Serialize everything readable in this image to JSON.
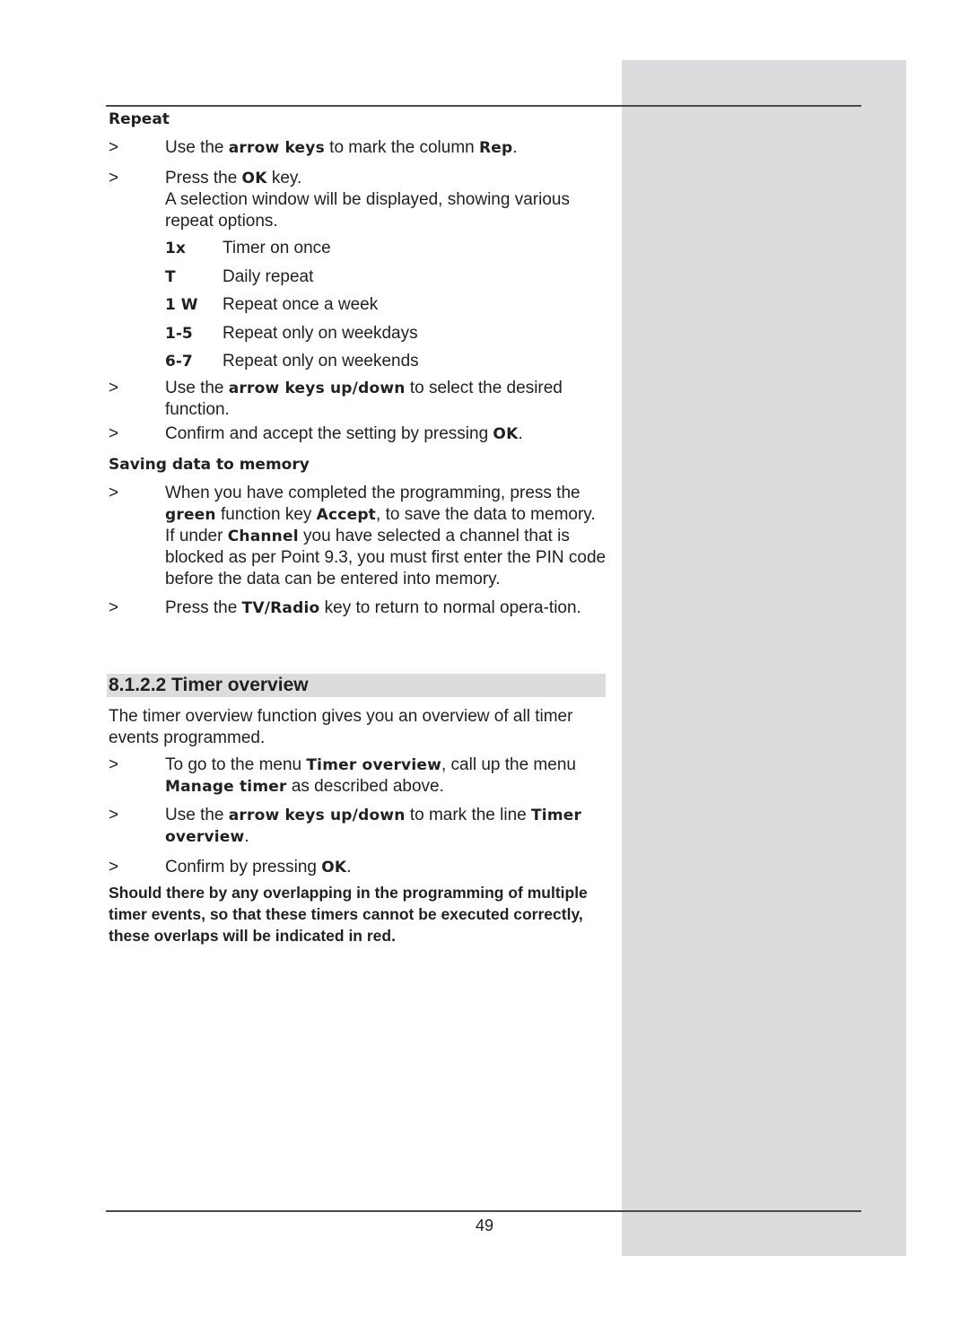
{
  "page": {
    "page_number": "49",
    "colors": {
      "side_panel": "#dcdcde",
      "rule": "#4a4a4a",
      "text": "#231f20"
    }
  },
  "repeat": {
    "heading": "Repeat",
    "step1": {
      "marker": ">",
      "pre": "Use the ",
      "b1": "arrow keys",
      "mid": " to mark the column ",
      "b2": "Rep",
      "post": "."
    },
    "step2": {
      "marker": ">",
      "pre": "Press the ",
      "b1": "OK",
      "post": " key.",
      "detail": "A selection window will be displayed, showing various repeat options."
    },
    "options": [
      {
        "code": "1x",
        "label": "Timer on once"
      },
      {
        "code": "T",
        "label": "Daily repeat"
      },
      {
        "code": "1 W",
        "label": "Repeat once a week"
      },
      {
        "code": "1-5",
        "label": "Repeat only on weekdays"
      },
      {
        "code": "6-7",
        "label": "Repeat only on weekends"
      }
    ],
    "step3": {
      "marker": ">",
      "pre": "Use the ",
      "b1": "arrow keys up/down",
      "post": " to select the desired function."
    },
    "step4": {
      "marker": ">",
      "pre": "Confirm and accept the setting by pressing ",
      "b1": "OK",
      "post": "."
    }
  },
  "saving": {
    "heading": "Saving data to memory",
    "step1": {
      "marker": ">",
      "pre": "When you have completed the programming, press the ",
      "b1": "green",
      "mid": " function key ",
      "b2": "Accept",
      "post": ", to save the data to memory.",
      "detail_pre": "If under ",
      "detail_b": "Channel",
      "detail_post": " you have selected a channel that is blocked as per Point 9.3, you must first enter the PIN code before the data can be entered into memory."
    },
    "step2": {
      "marker": ">",
      "pre": "Press the ",
      "b1": "TV/Radio",
      "post": " key to return to normal opera-tion."
    }
  },
  "timer_overview": {
    "heading": "8.1.2.2 Timer overview",
    "intro": "The timer overview function gives you an overview of all timer events programmed.",
    "step1": {
      "marker": ">",
      "pre": "To go to the menu ",
      "b1": "Timer overview",
      "mid": ", call up the menu ",
      "b2": "Manage timer",
      "post": " as described above."
    },
    "step2": {
      "marker": ">",
      "pre": "Use the ",
      "b1": "arrow keys up/down",
      "mid": " to mark the line ",
      "b2": "Timer overview",
      "post": "."
    },
    "step3": {
      "marker": ">",
      "pre": "Confirm by pressing ",
      "b1": "OK",
      "post": "."
    },
    "note": "Should there by any overlapping in the programming of multiple timer events, so that these timers cannot be executed correctly, these overlaps will be indicated in red."
  }
}
